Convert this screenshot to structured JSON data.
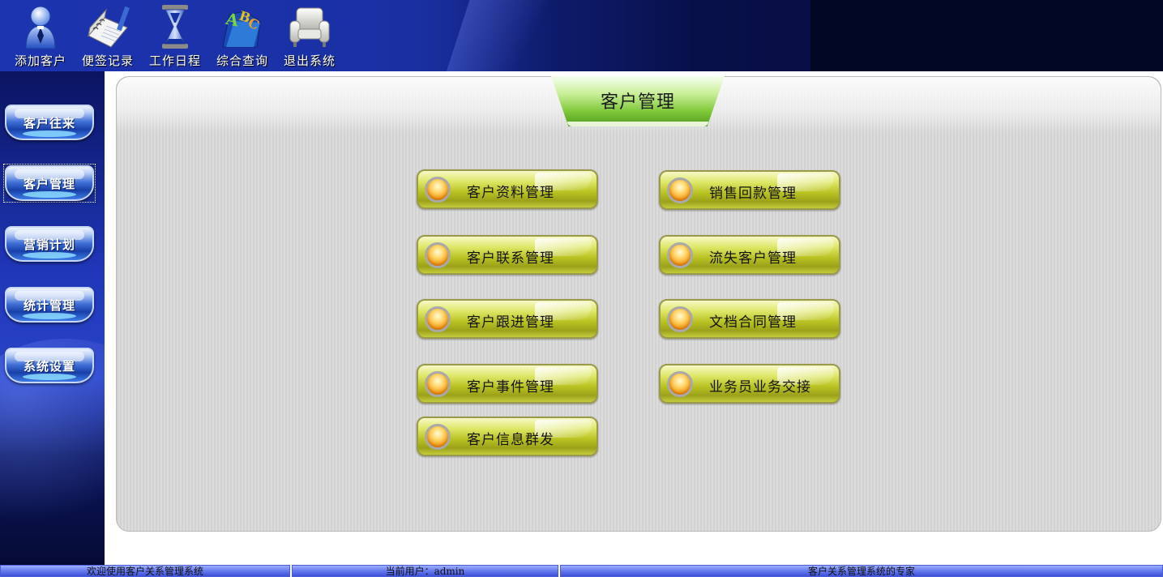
{
  "toolbar": {
    "items": [
      {
        "label": "添加客户",
        "icon": "person-icon"
      },
      {
        "label": "便签记录",
        "icon": "notebook-icon"
      },
      {
        "label": "工作日程",
        "icon": "hourglass-icon"
      },
      {
        "label": "综合查询",
        "icon": "abc-folder-icon"
      },
      {
        "label": "退出系统",
        "icon": "armchair-icon"
      }
    ]
  },
  "sidebar": {
    "items": [
      {
        "label": "客户往来"
      },
      {
        "label": "客户管理",
        "active": true
      },
      {
        "label": "营销计划"
      },
      {
        "label": "统计管理"
      },
      {
        "label": "系统设置"
      }
    ]
  },
  "main": {
    "title": "客户管理",
    "modules": [
      "客户资料管理",
      "销售回款管理",
      "客户联系管理",
      "流失客户管理",
      "客户跟进管理",
      "文档合同管理",
      "客户事件管理",
      "业务员业务交接",
      "客户信息群发"
    ]
  },
  "statusbar": {
    "welcome": "欢迎使用客户关系管理系统",
    "current_user": "当前用户：admin",
    "slogan": "客户关系管理系统的专家"
  },
  "colors": {
    "header_blue": "#1c34b0",
    "title_green": "#7fc83a",
    "module_yellow_green": "#b9c222",
    "orb_orange": "#f39a14"
  }
}
